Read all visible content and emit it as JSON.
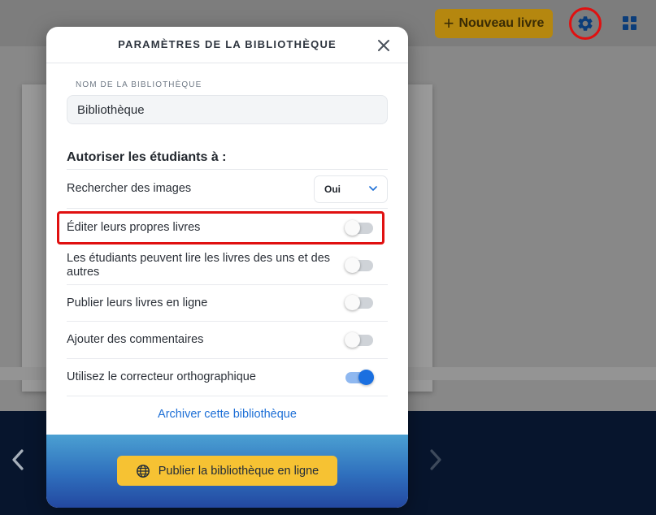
{
  "topbar": {
    "new_book_label": "Nouveau livre",
    "new_book_icon": "plus-icon",
    "settings_icon": "gear-icon",
    "grid_icon": "grid-icon"
  },
  "modal": {
    "title": "PARAMÈTRES DE LA BIBLIOTHÈQUE",
    "close_icon": "close-icon",
    "name_field_label": "NOM DE LA BIBLIOTHÈQUE",
    "name_value": "Bibliothèque",
    "section_heading": "Autoriser les étudiants à :",
    "rows": [
      {
        "label": "Rechercher des images",
        "control": "select",
        "value": "Oui"
      },
      {
        "label": "Éditer leurs propres livres",
        "control": "toggle",
        "on": false
      },
      {
        "label": "Les étudiants peuvent lire les livres des uns et des autres",
        "control": "toggle",
        "on": false
      },
      {
        "label": "Publier leurs livres en ligne",
        "control": "toggle",
        "on": false
      },
      {
        "label": "Ajouter des commentaires",
        "control": "toggle",
        "on": false
      },
      {
        "label": "Utilisez le correcteur orthographique",
        "control": "toggle",
        "on": true
      }
    ],
    "archive_link": "Archiver cette bibliothèque",
    "publish_button": "Publier la bibliothèque en ligne",
    "publish_icon": "globe-icon"
  },
  "colors": {
    "accent_yellow": "#f6c233",
    "link_blue": "#1d6fd6",
    "toggle_on": "#1a6fe0",
    "highlight_red": "#e01010"
  }
}
